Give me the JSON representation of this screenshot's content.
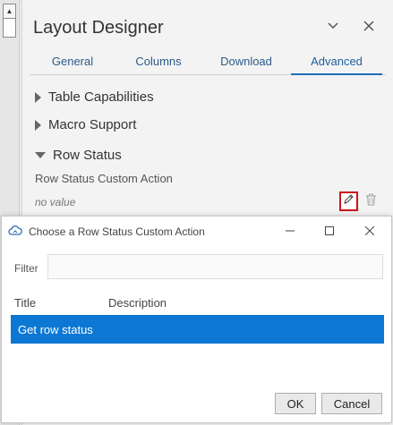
{
  "designer": {
    "title": "Layout Designer",
    "tabs": [
      {
        "label": "General"
      },
      {
        "label": "Columns"
      },
      {
        "label": "Download"
      },
      {
        "label": "Advanced"
      }
    ],
    "active_tab": "Advanced",
    "sections": [
      {
        "label": "Table Capabilities",
        "expanded": false
      },
      {
        "label": "Macro Support",
        "expanded": false
      },
      {
        "label": "Row Status",
        "expanded": true
      }
    ],
    "row_status": {
      "field_label": "Row Status Custom Action",
      "value": "no value"
    }
  },
  "dialog": {
    "title": "Choose a Row Status Custom Action",
    "filter_label": "Filter",
    "filter_value": "",
    "columns": [
      "Title",
      "Description"
    ],
    "rows": [
      {
        "title": "Get row status",
        "description": "",
        "selected": true
      }
    ],
    "ok_label": "OK",
    "cancel_label": "Cancel"
  },
  "colors": {
    "accent": "#0c78d4",
    "highlight_border": "#d0121b"
  }
}
